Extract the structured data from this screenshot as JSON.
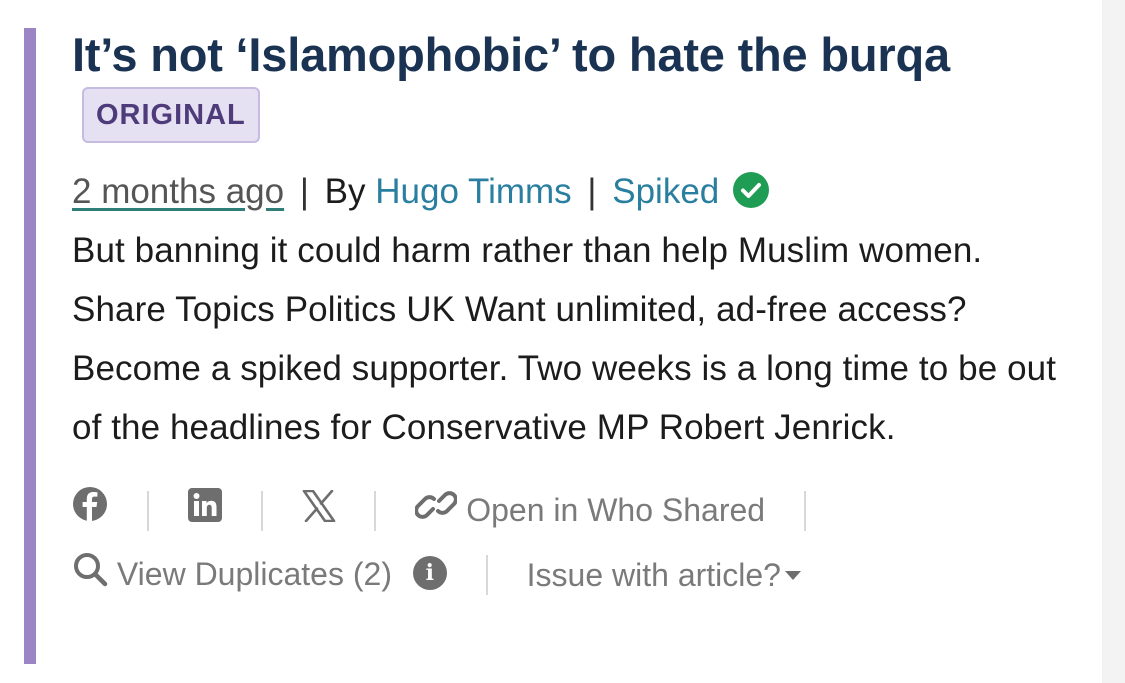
{
  "article": {
    "title": "It’s not ‘Islamophobic’ to hate the burqa",
    "badge": "ORIGINAL",
    "time": "2 months ago",
    "by_prefix": "By",
    "author": "Hugo Timms",
    "source": "Spiked",
    "summary": "But banning it could harm rather than help Muslim women. Share Topics Politics UK Want unlimited, ad-free access? Become a spiked supporter. Two weeks is a long time to be out of the headlines for Conservative MP Robert Jenrick.",
    "separator": "|"
  },
  "actions": {
    "open_label": "Open in Who Shared",
    "view_duplicates_label": "View Duplicates (2)",
    "issue_label": "Issue with article?"
  },
  "icons": {
    "facebook": "facebook-icon",
    "linkedin": "linkedin-icon",
    "x": "x-icon",
    "link": "link-icon",
    "search": "search-icon",
    "info": "info-icon",
    "verified": "verified-check-icon"
  },
  "colors": {
    "accent_bar": "#9b85c4",
    "title": "#1b3353",
    "badge_bg": "#e6e0f3",
    "link": "#2a7fa0",
    "verified": "#1f9d55"
  }
}
